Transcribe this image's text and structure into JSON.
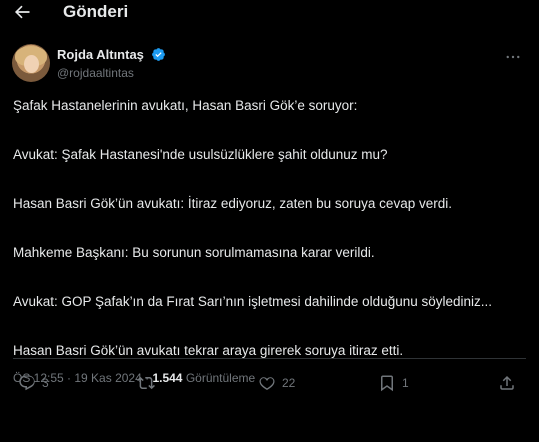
{
  "header": {
    "title": "Gönderi"
  },
  "author": {
    "name": "Rojda Altıntaş",
    "handle": "@rojdaaltintas",
    "verified": true,
    "accent_color": "#1d9bf0"
  },
  "tweet": {
    "paragraphs": [
      "Şafak Hastanelerinin avukatı, Hasan Basri Gök’e soruyor:",
      "Avukat: Şafak Hastanesi'nde usulsüzlüklere şahit oldunuz mu?",
      "Hasan Basri Gök’ün avukatı: İtiraz ediyoruz, zaten bu soruya cevap verdi.",
      "Mahkeme Başkanı: Bu sorunun sorulmamasına karar verildi.",
      "Avukat: GOP Şafak’ın da Fırat Sarı’nın işletmesi dahilinde olduğunu söylediniz...",
      "Hasan Basri Gök’ün avukatı tekrar araya girerek soruya itiraz etti."
    ]
  },
  "meta": {
    "time": "ÖS 12:55",
    "separator": " · ",
    "date": "19 Kas 2024",
    "views_count": "1.544",
    "views_label": "Görüntüleme"
  },
  "actions": {
    "reply_count": "3",
    "retweet_count": "",
    "like_count": "22",
    "bookmark_count": "1"
  },
  "icons": [
    "back-arrow-icon",
    "verified-badge-icon",
    "more-icon",
    "reply-icon",
    "retweet-icon",
    "like-icon",
    "bookmark-icon",
    "share-icon"
  ]
}
